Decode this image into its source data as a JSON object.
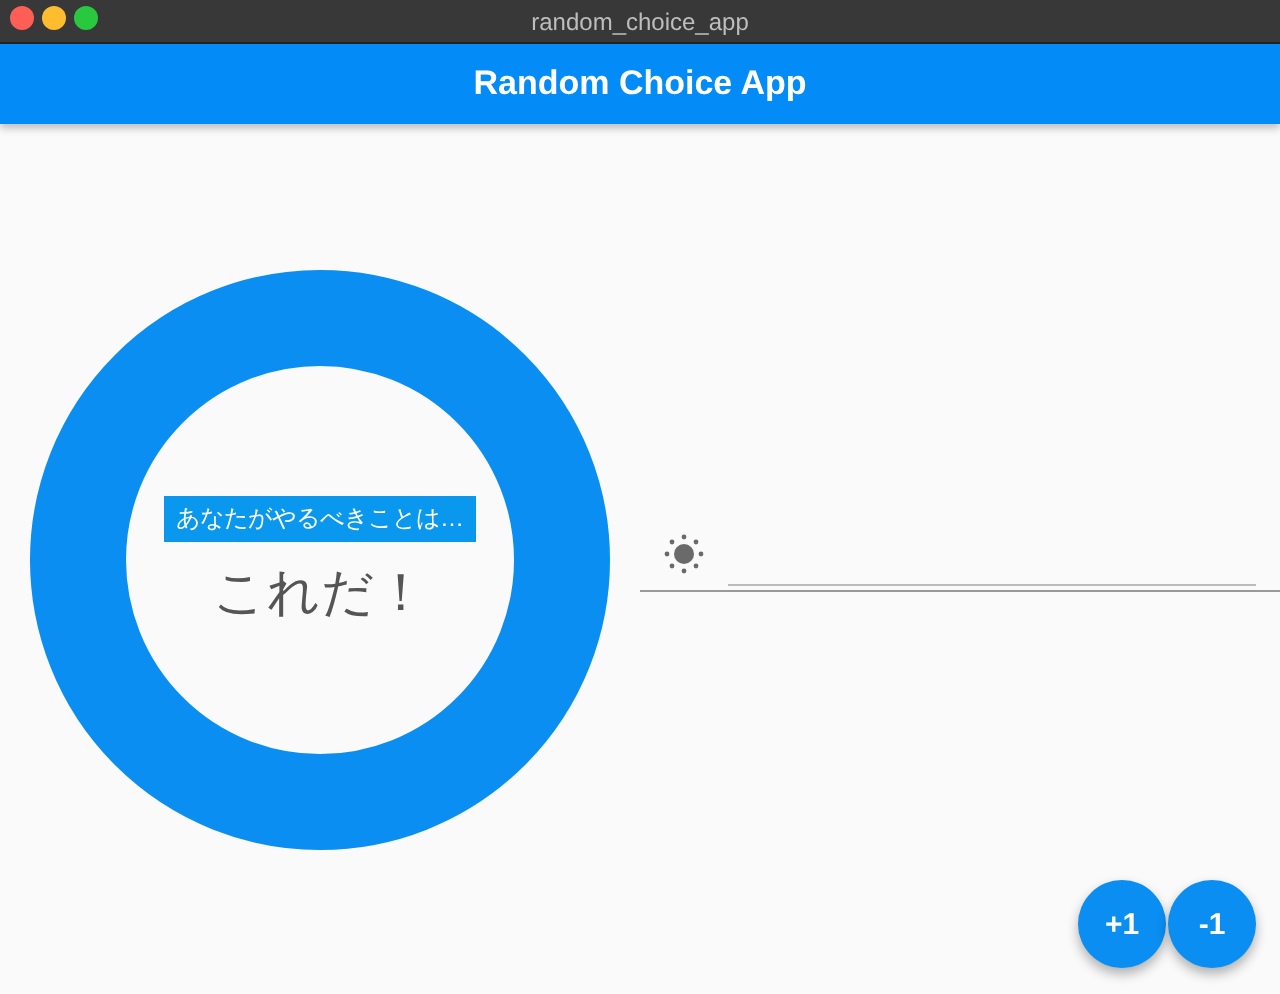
{
  "window": {
    "title": "random_choice_app"
  },
  "app_bar": {
    "title": "Random Choice App"
  },
  "result": {
    "caption": "あなたがやるべきことは…",
    "answer": "これだ！"
  },
  "buttons": [
    {
      "label": "+1"
    },
    {
      "label": "-1"
    }
  ]
}
